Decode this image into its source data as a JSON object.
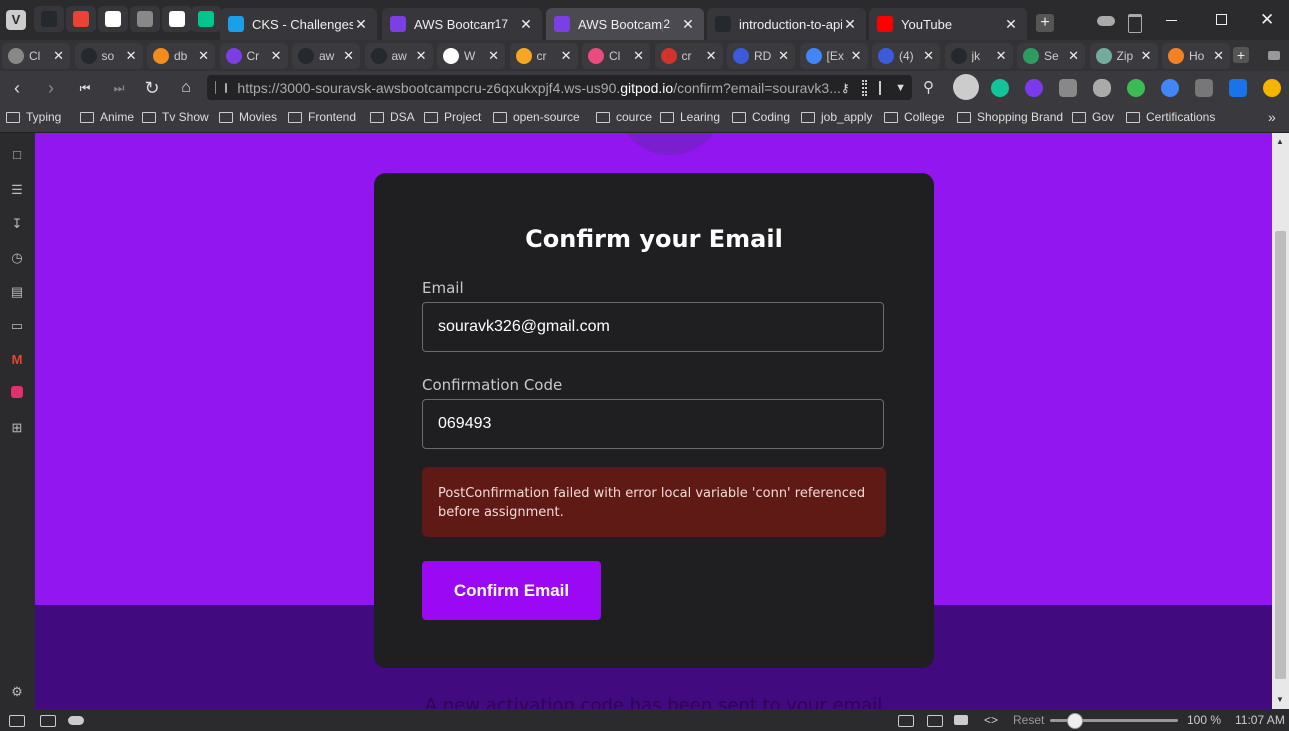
{
  "tabs_row1": [
    {
      "icon": "github-icon",
      "label": "",
      "color": "#24292e"
    },
    {
      "icon": "gmail-icon",
      "label": "",
      "color": "#ea4335"
    },
    {
      "icon": "notion-icon",
      "label": "",
      "color": "#ffffff"
    },
    {
      "icon": "globe-icon",
      "label": "",
      "color": "#888888"
    },
    {
      "icon": "wikipedia-icon",
      "label": "",
      "color": "#ffffff"
    },
    {
      "icon": "vuejs-icon",
      "label": "",
      "color": "#00c58e"
    }
  ],
  "wide_tabs": [
    {
      "label": "CKS - Challenges -",
      "count": "",
      "icon": "eye-icon",
      "color": "#1aa0e8",
      "active": false
    },
    {
      "label": "AWS Bootcamp",
      "count": "17",
      "icon": "bootcamp-icon",
      "color": "#7b3fe4",
      "active": false
    },
    {
      "label": "AWS Bootcamp",
      "count": "2",
      "icon": "gitpod-icon",
      "color": "#7b3fe4",
      "active": true
    },
    {
      "label": "introduction-to-api",
      "count": "",
      "icon": "github-icon",
      "color": "#24292e",
      "active": false
    },
    {
      "label": "YouTube",
      "count": "",
      "icon": "youtube-icon",
      "color": "#ff0000",
      "active": false
    }
  ],
  "tabs_row2": [
    {
      "label": "Cl",
      "color": "#888888"
    },
    {
      "label": "so",
      "color": "#24292e"
    },
    {
      "label": "db",
      "color": "#f28c1c"
    },
    {
      "label": "Cr",
      "color": "#7b3fe4"
    },
    {
      "label": "aw",
      "color": "#24292e"
    },
    {
      "label": "aw",
      "color": "#24292e"
    },
    {
      "label": "W",
      "color": "#ffffff"
    },
    {
      "label": "cr",
      "color": "#f5a623"
    },
    {
      "label": "Cl",
      "color": "#e94b7c"
    },
    {
      "label": "cr",
      "color": "#d0342c"
    },
    {
      "label": "RD",
      "color": "#3b5bdb"
    },
    {
      "label": "[Ex",
      "color": "#4285f4"
    },
    {
      "label": "(4)",
      "color": "#3b5bdb"
    },
    {
      "label": "jk",
      "color": "#24292e"
    },
    {
      "label": "Se",
      "color": "#2e9c5f"
    },
    {
      "label": "Zip",
      "color": "#74aa9c"
    },
    {
      "label": "Ho",
      "color": "#f48024"
    }
  ],
  "url": {
    "prefix": "https://3000-souravsk-awsbootcampcru-z6qxukxpjf4.ws-us90.",
    "domain": "gitpod.io",
    "suffix": "/confirm?email=souravk3..."
  },
  "bookmarks": [
    "Typing",
    "Anime",
    "Tv Show",
    "Movies",
    "Frontend",
    "DSA",
    "Project",
    "open-source",
    "cource",
    "Learing",
    "Coding",
    "job_apply",
    "College",
    "Shopping Brand",
    "Gov",
    "Certifications"
  ],
  "page": {
    "title": "Confirm your Email",
    "email_label": "Email",
    "email_value": "souravk326@gmail.com",
    "code_label": "Confirmation Code",
    "code_value": "069493",
    "error": "PostConfirmation failed with error local variable 'conn' referenced before assignment.",
    "button": "Confirm Email",
    "note": "A new activation code has been sent to your email"
  },
  "status": {
    "reset": "Reset",
    "zoom": "100 %",
    "time": "11:07 AM"
  },
  "colors": {
    "page_bg": "#9216f0",
    "card_bg": "#1f1f22",
    "error_bg": "#5f1a15",
    "button_bg": "#9b08f4"
  }
}
